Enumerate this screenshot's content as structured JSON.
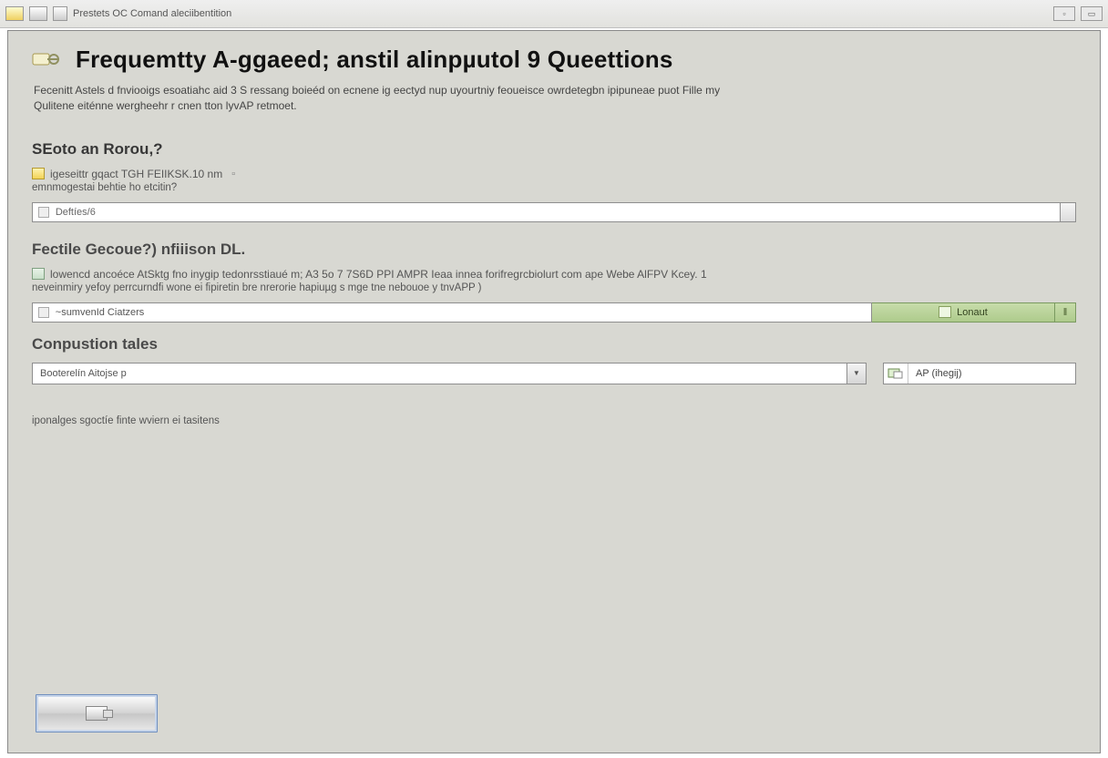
{
  "window": {
    "caption": "Prestets OC Comand aleciibentition",
    "controls": {
      "min": "▫",
      "max": "▭"
    }
  },
  "page": {
    "title": "Frequemtty A-ggaeed; anstil aIinpµutol 9 Queettions",
    "intro_line1": "Fecenitt Astels d fnviooigs esoatiahc aid 3 S ressang boieéd on ecnene ig eectyd nup uyourtniy feoueisce owrdetegbn ipipuneae puot Fille my",
    "intro_line2": "Qulitene eiténne wergheehr r cnen tton lyvAP retmoet."
  },
  "section1": {
    "heading": "SEoto an Rorou,?",
    "note_prefix": "igeseittr gqact TGH FEIIKSK.10 nm",
    "note_muted": "",
    "sub_note": "emnmogestai behtie ho etcitin?",
    "field_value": "Deftíes/6"
  },
  "section2": {
    "heading": "Fectile Gecoue?) nfiiison DL.",
    "note_text": "lowencd ancoéce AtSktg fno inygip tedonrsstiaué m; A3 5o 7 7S6D PPI AMPR Ieaa innea forifregrcbiolurt com ape Webe AlFPV Kcey. 1",
    "sub_note2": "neveinmiry yefoy perrcurndfi wone ei fipiretin bre nrerorie hapiuµg s mge tne nebouoe y tnvAPP )",
    "field2_value": "~sumvenId Ciatzers",
    "green_button": "Lonaut",
    "end_cap": "‖"
  },
  "section3": {
    "heading": "Conpustion tales",
    "combo_value": "Booterelín Aitojse p",
    "side_button": "AP (ihegij)"
  },
  "footer_note": "iponalges sgoctíe finte wviern ei tasitens"
}
